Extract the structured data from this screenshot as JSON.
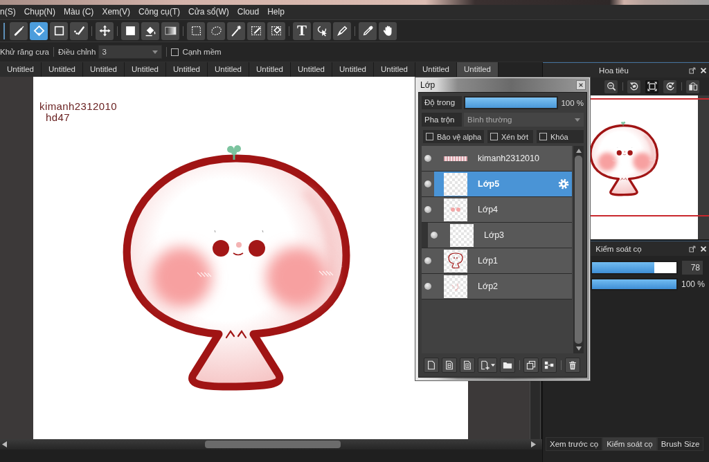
{
  "menu_bar": {
    "items": [
      "n(S)",
      "Chụp(N)",
      "Màu (C)",
      "Xem(V)",
      "Công cụ(T)",
      "Cửa sổ(W)",
      "Cloud",
      "Help"
    ]
  },
  "toolbar": {
    "groups": [
      [
        {
          "kind": "brush",
          "selected": false
        },
        {
          "kind": "eraser",
          "selected": true
        },
        {
          "kind": "square",
          "selected": false
        },
        {
          "kind": "dotted-brush",
          "selected": false
        }
      ],
      [
        {
          "kind": "move",
          "selected": false
        }
      ],
      [
        {
          "kind": "fill-rect",
          "selected": false
        },
        {
          "kind": "bucket",
          "selected": false
        },
        {
          "kind": "gradient",
          "selected": false
        }
      ],
      [
        {
          "kind": "select-rect",
          "selected": false
        },
        {
          "kind": "lasso",
          "selected": false
        },
        {
          "kind": "magic-wand",
          "selected": false
        },
        {
          "kind": "select-pen",
          "selected": false
        },
        {
          "kind": "select-eraser",
          "selected": false
        }
      ],
      [
        {
          "kind": "text",
          "glyph": "T",
          "selected": false
        },
        {
          "kind": "pointer",
          "selected": false
        },
        {
          "kind": "pen",
          "selected": false
        }
      ],
      [
        {
          "kind": "eyedropper",
          "selected": false
        },
        {
          "kind": "hand",
          "selected": false
        }
      ]
    ]
  },
  "tool_options": {
    "antialias": "Khử răng cưa",
    "correction": {
      "label": "Điều chỉnh",
      "value": "3"
    },
    "soft_edge": {
      "label": "Cạnh mềm",
      "checked": false
    }
  },
  "document_tabs": [
    {
      "label": "Untitled",
      "selected": false
    },
    {
      "label": "Untitled",
      "selected": false
    },
    {
      "label": "Untitled",
      "selected": false
    },
    {
      "label": "Untitled",
      "selected": false
    },
    {
      "label": "Untitled",
      "selected": false
    },
    {
      "label": "Untitled",
      "selected": false
    },
    {
      "label": "Untitled",
      "selected": false
    },
    {
      "label": "Untitled",
      "selected": false
    },
    {
      "label": "Untitled",
      "selected": false
    },
    {
      "label": "Untitled",
      "selected": false
    },
    {
      "label": "Untitled",
      "selected": false
    },
    {
      "label": "Untitled",
      "selected": true
    }
  ],
  "canvas": {
    "signature": [
      "kimanh2312010",
      "hd47"
    ]
  },
  "layer_panel": {
    "title": "Lớp",
    "opacity": {
      "label": "Độ trong",
      "level": 1,
      "reading": "100 %"
    },
    "blend": {
      "label": "Pha trộn",
      "value": "Bình thường"
    },
    "options": [
      {
        "label": "Bảo vệ alpha",
        "checked": false
      },
      {
        "label": "Xén bớt",
        "checked": false
      },
      {
        "label": "Khóa",
        "checked": false
      }
    ],
    "layers": [
      {
        "name": "kimanh2312010",
        "kind": "text",
        "visible": true,
        "clipped": false,
        "selected": false
      },
      {
        "name": "Lớp5",
        "kind": "blank",
        "visible": true,
        "clipped": false,
        "selected": true
      },
      {
        "name": "Lớp4",
        "kind": "blush",
        "visible": true,
        "clipped": false,
        "selected": false
      },
      {
        "name": "Lớp3",
        "kind": "blank",
        "visible": true,
        "clipped": true,
        "selected": false
      },
      {
        "name": "Lớp1",
        "kind": "outline",
        "visible": true,
        "clipped": false,
        "selected": false
      },
      {
        "name": "Lớp2",
        "kind": "sketch",
        "visible": true,
        "clipped": false,
        "selected": false
      }
    ],
    "actions": [
      [
        {
          "kind": "page"
        },
        {
          "kind": "page-box"
        },
        {
          "kind": "page-frame"
        },
        {
          "kind": "add-page"
        },
        {
          "kind": "folder"
        }
      ],
      [
        {
          "kind": "duplicate"
        },
        {
          "kind": "merge"
        }
      ],
      [
        {
          "kind": "delete"
        }
      ]
    ]
  },
  "navigator": {
    "title": "Hoa tiêu",
    "tool_groups": [
      [
        {
          "kind": "zoom-out",
          "selected": false
        }
      ],
      [
        {
          "kind": "rotate-left",
          "selected": false
        },
        {
          "kind": "fit",
          "selected": true
        },
        {
          "kind": "rotate-right",
          "selected": false
        }
      ],
      [
        {
          "kind": "flip",
          "selected": false
        }
      ]
    ]
  },
  "brush_control": {
    "title": "Kiểm soát cọ",
    "sliders": [
      {
        "kind": "size",
        "level": 0.74,
        "reading": "78"
      },
      {
        "kind": "opacity",
        "level": 1,
        "reading": "100 %"
      }
    ]
  },
  "panel_tabs": [
    {
      "label": "Xem trước cọ",
      "selected": false
    },
    {
      "label": "Kiểm soát cọ",
      "selected": true
    },
    {
      "label": "Brush Size",
      "selected": false
    }
  ]
}
